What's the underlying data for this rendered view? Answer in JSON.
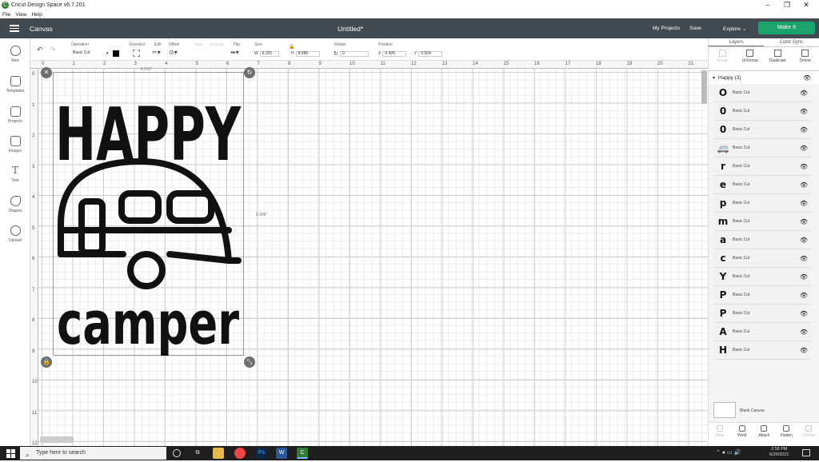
{
  "titlebar": {
    "title": "Cricut Design Space  v6.7.201",
    "app_icon": "cricut-c-icon",
    "controls": [
      "–",
      "❐",
      "✕"
    ]
  },
  "menubar": {
    "items": [
      "File",
      "View",
      "Help"
    ]
  },
  "header": {
    "section": "Canvas",
    "document": "Untitled*",
    "my_projects": "My Projects",
    "save": "Save",
    "explore": "Explore",
    "make_it": "Make It",
    "accent": "#1aa36b",
    "bar_color": "#414951"
  },
  "toolbar": {
    "operation_label": "Operation",
    "operation_value": "Basic Cut",
    "deselect": "Deselect",
    "edit": "Edit",
    "offset": "Offset",
    "align": "Align",
    "arrange": "Arrange",
    "flip": "Flip",
    "size": "Size",
    "w_label": "W",
    "w_value": "6.201",
    "h_label": "H",
    "h_value": "8.986",
    "rotate": "Rotate",
    "rotate_value": "0",
    "position": "Position",
    "x_label": "X",
    "x_value": "0.426",
    "y_label": "Y",
    "y_value": "0.504",
    "swatch_color": "#000000"
  },
  "leftnav": [
    "New",
    "Templates",
    "Projects",
    "Images",
    "Text",
    "Shapes",
    "Upload"
  ],
  "ruler": {
    "top": [
      "0",
      "1",
      "2",
      "3",
      "4",
      "5",
      "6",
      "7",
      "8",
      "9",
      "10",
      "11",
      "12",
      "13",
      "14",
      "15",
      "16",
      "17",
      "18",
      "19",
      "20",
      "21"
    ],
    "left": [
      "0",
      "1",
      "2",
      "3",
      "4",
      "5",
      "6",
      "7",
      "8",
      "9",
      "10",
      "11",
      "12"
    ]
  },
  "canvas": {
    "width_readout": "6.201\"",
    "height_readout": "8.986\"",
    "art_text_top": "HAPPY",
    "art_text_bottom": "camper"
  },
  "panel": {
    "tabs": [
      "Layers",
      "Color Sync"
    ],
    "tools": [
      "Group",
      "UnGroup",
      "Duplicate",
      "Delete"
    ],
    "group_name": "Happy (3)",
    "layers": [
      {
        "glyph": "O",
        "label": "Basic Cut"
      },
      {
        "glyph": "0",
        "label": "Basic Cut"
      },
      {
        "glyph": "0",
        "label": "Basic Cut"
      },
      {
        "glyph": "🚐",
        "label": "Basic Cut"
      },
      {
        "glyph": "r",
        "label": "Basic Cut"
      },
      {
        "glyph": "e",
        "label": "Basic Cut"
      },
      {
        "glyph": "p",
        "label": "Basic Cut"
      },
      {
        "glyph": "m",
        "label": "Basic Cut"
      },
      {
        "glyph": "a",
        "label": "Basic Cut"
      },
      {
        "glyph": "c",
        "label": "Basic Cut"
      },
      {
        "glyph": "Y",
        "label": "Basic Cut"
      },
      {
        "glyph": "P",
        "label": "Basic Cut"
      },
      {
        "glyph": "P",
        "label": "Basic Cut"
      },
      {
        "glyph": "A",
        "label": "Basic Cut"
      },
      {
        "glyph": "H",
        "label": "Basic Cut"
      }
    ],
    "blank_canvas": "Blank Canvas",
    "bottom_tools": [
      "Slice",
      "Weld",
      "Attach",
      "Flatten",
      "Contour"
    ]
  },
  "taskbar": {
    "search_placeholder": "Type here to search",
    "time": "2:58 PM",
    "date": "6/29/2021"
  }
}
